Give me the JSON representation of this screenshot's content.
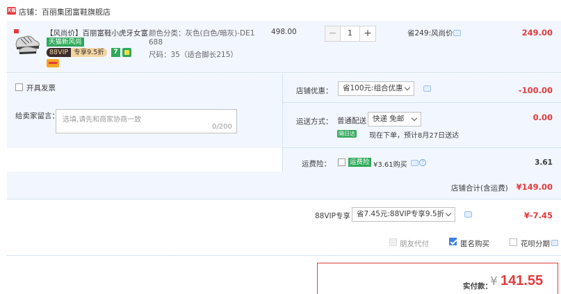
{
  "shop": {
    "logo_text": "天猫",
    "label": "店铺：百丽集团富鞋旗舰店"
  },
  "item": {
    "title": "【风尚价】百丽富鞋小虎牙女富...",
    "badge_new": "天猫新风尚",
    "vip_left": "88VIP",
    "vip_right": "专享9.5折",
    "seven_badge": "7",
    "sku_line1": "颜色分类：灰色(白色/暗灰)-DE1",
    "sku_line1b": "688",
    "sku_line2": "尺码：35（适合脚长215）",
    "unit_price": "498.00",
    "qty": "1",
    "qty_minus": "−",
    "qty_plus": "+",
    "save_label": "省249:风尚价",
    "total": "249.00"
  },
  "invoice": {
    "label": "开具发票"
  },
  "message": {
    "label": "给卖家留言：",
    "placeholder": "选填,请先和商家协商一致",
    "counter": "0/200"
  },
  "shop_discount": {
    "label": "店铺优惠：",
    "selected": "省100元:组合优惠",
    "amount": "-100.00"
  },
  "shipping": {
    "label": "运送方式：",
    "type": "普通配送",
    "selected": "快递 免邮",
    "amount": "0.00",
    "date_badge": "隔日达",
    "date_text": "现在下单，预计8月27日送达"
  },
  "insurance": {
    "label": "运费险：",
    "badge": "运费险",
    "text": "¥3.61购买",
    "help": "?",
    "amount": "3.61"
  },
  "shop_total": {
    "label": "店铺合计(含运费)",
    "amount": "¥149.00"
  },
  "vip_discount": {
    "label": "88VIP专享",
    "selected": "省7.45元:88VIP专享9.5折",
    "amount": "¥-7.45"
  },
  "options": [
    {
      "label": "朋友代付",
      "state": "disabled"
    },
    {
      "label": "匿名购买",
      "state": "checked"
    },
    {
      "label": "花呗分期",
      "state": "unchecked"
    }
  ],
  "payment": {
    "label": "实付款：",
    "currency": "¥",
    "amount": "141.55"
  },
  "colors": {
    "accent_red": "#e4393c",
    "panel_blue": "#f2f7ff",
    "green_badge": "#2fa95a",
    "checkbox_blue": "#3d7fe0"
  }
}
